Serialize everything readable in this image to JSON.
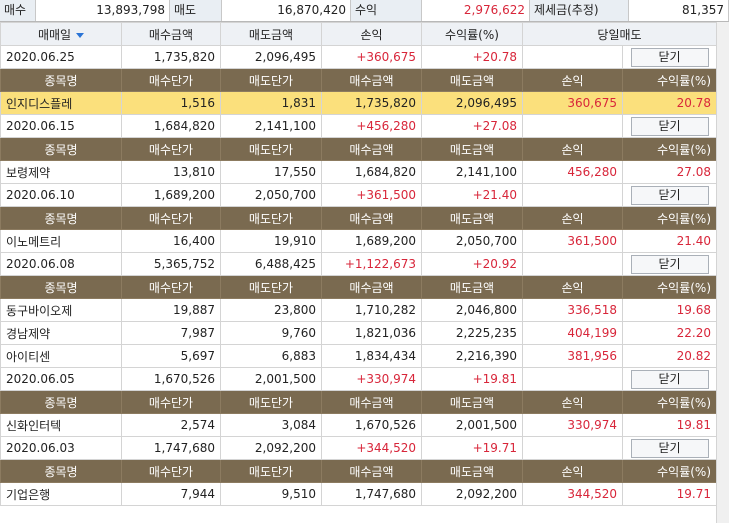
{
  "summary": {
    "buy_label": "매수",
    "buy_value": "13,893,798",
    "sell_label": "매도",
    "sell_value": "16,870,420",
    "profit_label": "수익",
    "profit_value": "2,976,622",
    "tax_label": "제세금(추정)",
    "tax_value": "81,357"
  },
  "columns": [
    "매매일",
    "매수금액",
    "매도금액",
    "손익",
    "수익률(%)",
    "당일매도"
  ],
  "sub_columns": [
    "종목명",
    "매수단가",
    "매도단가",
    "매수금액",
    "매도금액",
    "손익",
    "수익률(%)"
  ],
  "close_label": "닫기",
  "groups": [
    {
      "date": "2020.06.25",
      "buy": "1,735,820",
      "sell": "2,096,495",
      "pl": "+360,675",
      "rate": "+20.78",
      "items": [
        {
          "name": "인지디스플레",
          "buy_price": "1,516",
          "sell_price": "1,831",
          "buy": "1,735,820",
          "sell": "2,096,495",
          "pl": "360,675",
          "rate": "20.78"
        }
      ]
    },
    {
      "date": "2020.06.15",
      "buy": "1,684,820",
      "sell": "2,141,100",
      "pl": "+456,280",
      "rate": "+27.08",
      "items": [
        {
          "name": "보령제약",
          "buy_price": "13,810",
          "sell_price": "17,550",
          "buy": "1,684,820",
          "sell": "2,141,100",
          "pl": "456,280",
          "rate": "27.08"
        }
      ]
    },
    {
      "date": "2020.06.10",
      "buy": "1,689,200",
      "sell": "2,050,700",
      "pl": "+361,500",
      "rate": "+21.40",
      "items": [
        {
          "name": "이노메트리",
          "buy_price": "16,400",
          "sell_price": "19,910",
          "buy": "1,689,200",
          "sell": "2,050,700",
          "pl": "361,500",
          "rate": "21.40"
        }
      ]
    },
    {
      "date": "2020.06.08",
      "buy": "5,365,752",
      "sell": "6,488,425",
      "pl": "+1,122,673",
      "rate": "+20.92",
      "items": [
        {
          "name": "동구바이오제",
          "buy_price": "19,887",
          "sell_price": "23,800",
          "buy": "1,710,282",
          "sell": "2,046,800",
          "pl": "336,518",
          "rate": "19.68"
        },
        {
          "name": "경남제약",
          "buy_price": "7,987",
          "sell_price": "9,760",
          "buy": "1,821,036",
          "sell": "2,225,235",
          "pl": "404,199",
          "rate": "22.20"
        },
        {
          "name": "아이티센",
          "buy_price": "5,697",
          "sell_price": "6,883",
          "buy": "1,834,434",
          "sell": "2,216,390",
          "pl": "381,956",
          "rate": "20.82"
        }
      ]
    },
    {
      "date": "2020.06.05",
      "buy": "1,670,526",
      "sell": "2,001,500",
      "pl": "+330,974",
      "rate": "+19.81",
      "items": [
        {
          "name": "신화인터텍",
          "buy_price": "2,574",
          "sell_price": "3,084",
          "buy": "1,670,526",
          "sell": "2,001,500",
          "pl": "330,974",
          "rate": "19.81"
        }
      ]
    },
    {
      "date": "2020.06.03",
      "buy": "1,747,680",
      "sell": "2,092,200",
      "pl": "+344,520",
      "rate": "+19.71",
      "items": [
        {
          "name": "기업은행",
          "buy_price": "7,944",
          "sell_price": "9,510",
          "buy": "1,747,680",
          "sell": "2,092,200",
          "pl": "344,520",
          "rate": "19.71"
        }
      ]
    }
  ],
  "selected_item": "인지디스플레",
  "colors": {
    "subheader_bg": "#7a6a50",
    "selected_row": "#fbe07c",
    "positive": "#d8263a"
  }
}
